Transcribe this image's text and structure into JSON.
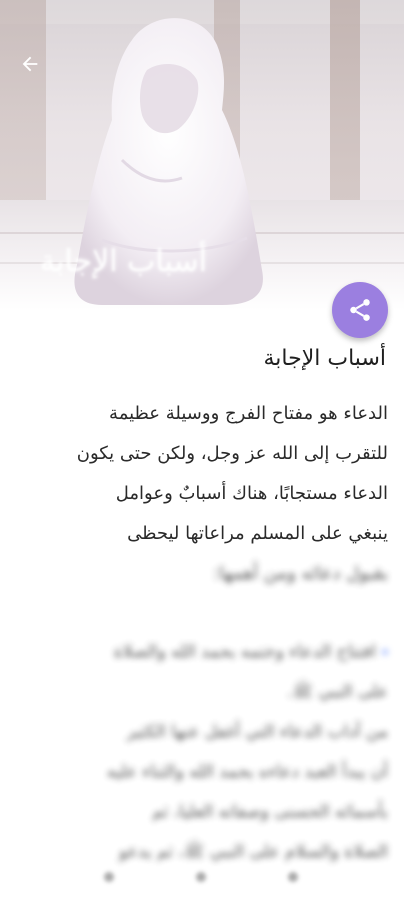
{
  "hero": {
    "title_overlay": "أسباب الإجابة"
  },
  "article": {
    "title": "أسباب الإجابة",
    "paragraph_lines": [
      "الدعاء هو مفتاح الفرج ووسيلة عظيمة",
      "للتقرب إلى الله عز وجل، ولكن حتى يكون",
      "الدعاء مستجابًا، هناك أسبابٌ وعوامل",
      "ينبغي على المسلم مراعاتها ليحظى",
      "بقبول دعائه ومن أهمها:"
    ],
    "blurred_lines": [
      "افتتاح الدعاء وختمه بحمد الله والصلاة",
      "على النبي ﷺ.",
      "من آداب الدعاء التي أغفل عنها الكثير",
      "أن يبدأ العبد دعاءه بحمد الله والثناء عليه",
      "بأسمائه الحسنى وصفاته العليا، ثم",
      "الصلاة والسلام على النبي ﷺ، ثم يدعو"
    ]
  },
  "icons": {
    "back": "arrow-left-icon",
    "share": "share-icon"
  },
  "colors": {
    "fab": "#9b7fe0",
    "bullet": "#8aa8ff",
    "text": "#2a2a2a"
  }
}
